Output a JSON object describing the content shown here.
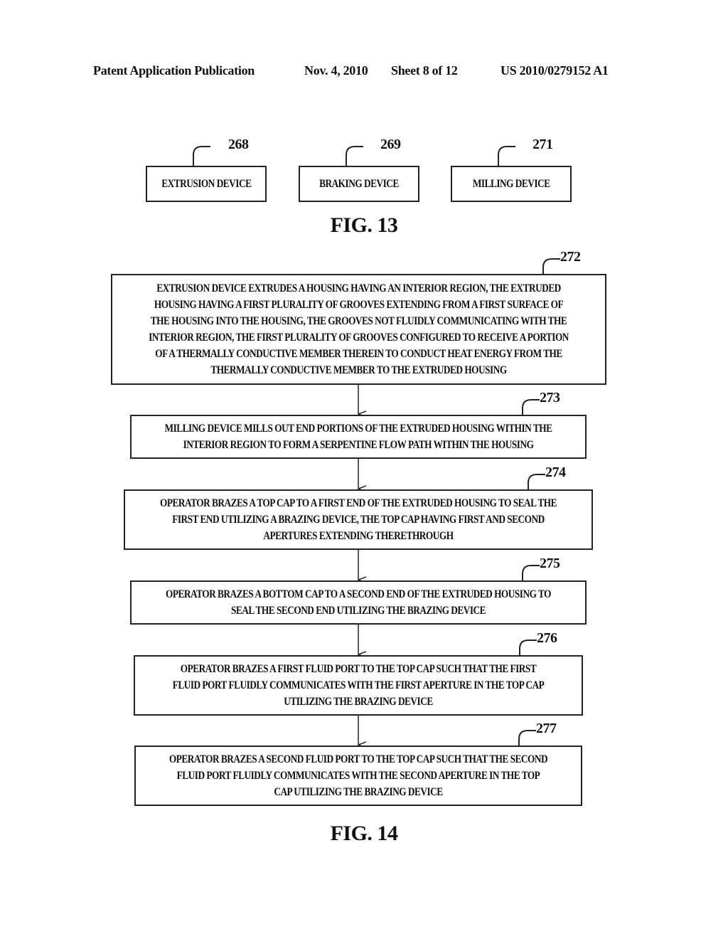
{
  "header": {
    "publication": "Patent Application Publication",
    "date": "Nov. 4, 2010",
    "sheet": "Sheet 8 of 12",
    "number": "US 2010/0279152 A1"
  },
  "fig13": {
    "label": "FIG. 13",
    "devices": [
      {
        "ref": "268",
        "text": "EXTRUSION DEVICE"
      },
      {
        "ref": "269",
        "text": "BRAKING DEVICE"
      },
      {
        "ref": "271",
        "text": "MILLING DEVICE"
      }
    ]
  },
  "fig14": {
    "label": "FIG. 14",
    "steps": [
      {
        "ref": "272",
        "text": "EXTRUSION DEVICE EXTRUDES A HOUSING HAVING AN INTERIOR REGION, THE EXTRUDED HOUSING HAVING A FIRST PLURALITY OF GROOVES EXTENDING FROM A FIRST SURFACE OF THE HOUSING INTO THE HOUSING, THE GROOVES NOT FLUIDLY COMMUNICATING WITH THE INTERIOR REGION, THE FIRST PLURALITY OF GROOVES CONFIGURED TO RECEIVE A PORTION OF A THERMALLY CONDUCTIVE MEMBER THEREIN TO CONDUCT HEAT ENERGY FROM THE THERMALLY CONDUCTIVE MEMBER TO THE EXTRUDED HOUSING"
      },
      {
        "ref": "273",
        "text": "MILLING DEVICE MILLS OUT END PORTIONS OF THE EXTRUDED HOUSING WITHIN THE INTERIOR REGION TO FORM A SERPENTINE FLOW PATH WITHIN THE HOUSING"
      },
      {
        "ref": "274",
        "text": "OPERATOR BRAZES A TOP CAP TO A FIRST END OF THE EXTRUDED HOUSING TO SEAL THE FIRST END UTILIZING A BRAZING DEVICE, THE TOP CAP HAVING FIRST AND SECOND APERTURES EXTENDING THERETHROUGH"
      },
      {
        "ref": "275",
        "text": "OPERATOR BRAZES A BOTTOM CAP TO A SECOND END OF THE EXTRUDED HOUSING TO SEAL THE SECOND END UTILIZING THE BRAZING DEVICE"
      },
      {
        "ref": "276",
        "text": "OPERATOR BRAZES A FIRST FLUID PORT TO THE TOP CAP SUCH THAT THE FIRST FLUID PORT FLUIDLY COMMUNICATES WITH THE FIRST APERTURE IN THE TOP CAP UTILIZING THE BRAZING DEVICE"
      },
      {
        "ref": "277",
        "text": "OPERATOR BRAZES A SECOND FLUID PORT TO THE TOP CAP SUCH THAT THE SECOND FLUID PORT FLUIDLY COMMUNICATES WITH THE SECOND APERTURE IN THE TOP CAP UTILIZING THE BRAZING DEVICE"
      }
    ]
  }
}
